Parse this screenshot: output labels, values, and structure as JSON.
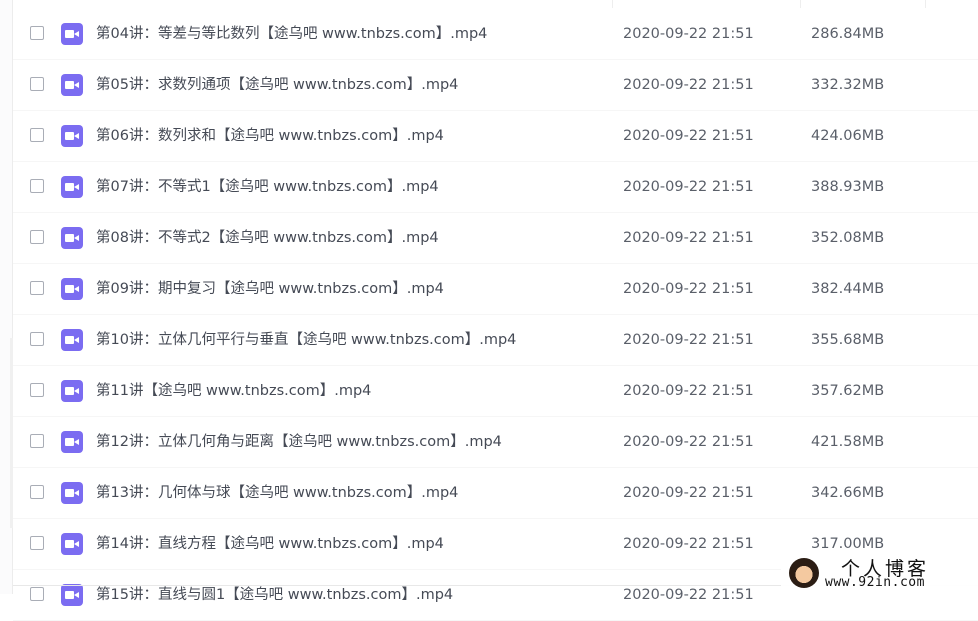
{
  "files": [
    {
      "name": "第04讲：等差与等比数列【途乌吧 www.tnbzs.com】.mp4",
      "date": "2020-09-22 21:51",
      "size": "286.84MB"
    },
    {
      "name": "第05讲：求数列通项【途乌吧 www.tnbzs.com】.mp4",
      "date": "2020-09-22 21:51",
      "size": "332.32MB"
    },
    {
      "name": "第06讲：数列求和【途乌吧 www.tnbzs.com】.mp4",
      "date": "2020-09-22 21:51",
      "size": "424.06MB"
    },
    {
      "name": "第07讲：不等式1【途乌吧 www.tnbzs.com】.mp4",
      "date": "2020-09-22 21:51",
      "size": "388.93MB"
    },
    {
      "name": "第08讲：不等式2【途乌吧 www.tnbzs.com】.mp4",
      "date": "2020-09-22 21:51",
      "size": "352.08MB"
    },
    {
      "name": "第09讲：期中复习【途乌吧 www.tnbzs.com】.mp4",
      "date": "2020-09-22 21:51",
      "size": "382.44MB"
    },
    {
      "name": "第10讲：立体几何平行与垂直【途乌吧 www.tnbzs.com】.mp4",
      "date": "2020-09-22 21:51",
      "size": "355.68MB"
    },
    {
      "name": "第11讲【途乌吧 www.tnbzs.com】.mp4",
      "date": "2020-09-22 21:51",
      "size": "357.62MB"
    },
    {
      "name": "第12讲：立体几何角与距离【途乌吧 www.tnbzs.com】.mp4",
      "date": "2020-09-22 21:51",
      "size": "421.58MB"
    },
    {
      "name": "第13讲：几何体与球【途乌吧 www.tnbzs.com】.mp4",
      "date": "2020-09-22 21:51",
      "size": "342.66MB"
    },
    {
      "name": "第14讲：直线方程【途乌吧 www.tnbzs.com】.mp4",
      "date": "2020-09-22 21:51",
      "size": "317.00MB"
    },
    {
      "name": "第15讲：直线与圆1【途乌吧 www.tnbzs.com】.mp4",
      "date": "2020-09-22 21:51",
      "size": ""
    }
  ],
  "watermark": {
    "title": "个人博客",
    "url": "www.92in.com"
  },
  "icons": {
    "file": "video-file-icon",
    "checkbox": "checkbox"
  },
  "colors": {
    "video_icon": "#7b6cf1"
  }
}
